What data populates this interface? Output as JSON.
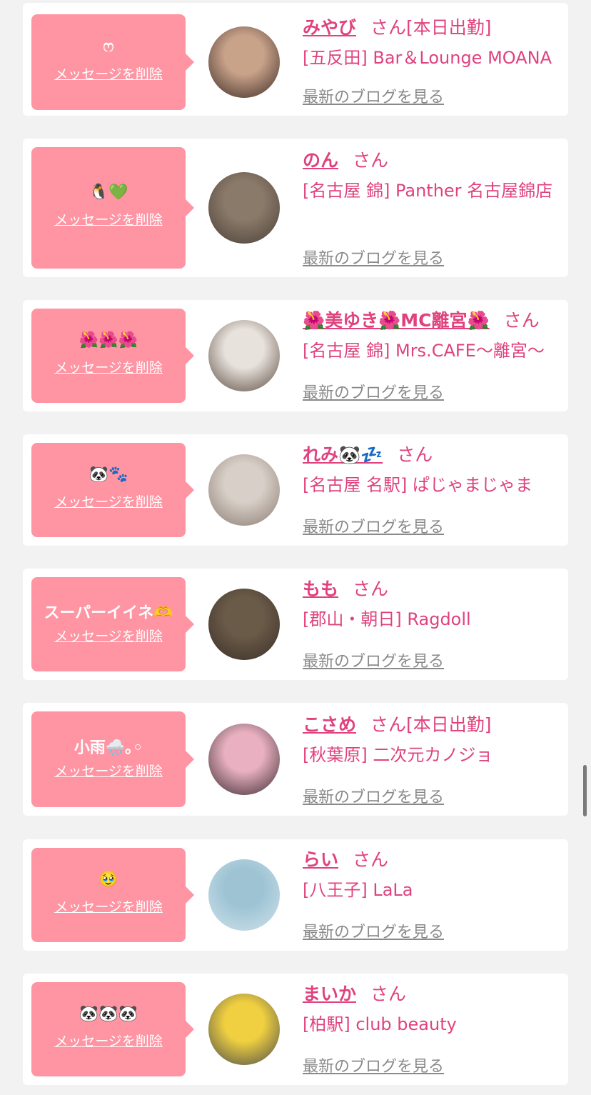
{
  "delete_label": "メッセージを削除",
  "blog_label": "最新のブログを見る",
  "san_label": "さん",
  "cards": [
    {
      "message": "ෆ",
      "name": "みやび",
      "status": "[本日出勤]",
      "shop": "[五反田] Bar＆Lounge MOANA",
      "avatar_colors": [
        "#c9a28a",
        "#3b2a24"
      ]
    },
    {
      "message": "🐧💚",
      "name": "のん",
      "status": "",
      "shop": "[名古屋 錦] Panther 名古屋錦店",
      "avatar_colors": [
        "#8a7a6a",
        "#4a3f36"
      ]
    },
    {
      "message": "🌺🌺🌺",
      "name": "🌺美ゆき🌺MC離宮🌺",
      "status": "",
      "shop": "[名古屋 錦] Mrs.CAFE〜離宮〜",
      "avatar_colors": [
        "#e8e2dc",
        "#5a4a40"
      ]
    },
    {
      "message": "🐼🐾",
      "name": "れみ🐼💤",
      "status": "",
      "shop": "[名古屋 名駅] ぱじゃまじゃま",
      "avatar_colors": [
        "#d8d0c8",
        "#8a7a70"
      ]
    },
    {
      "message": "スーパーイイネ🫶",
      "name": "もも",
      "status": "",
      "shop": "[郡山・朝日] Ragdoll",
      "avatar_colors": [
        "#6a5a48",
        "#3a3028"
      ]
    },
    {
      "message": "小雨🌧️｡◦",
      "name": "こさめ",
      "status": "[本日出勤]",
      "shop": "[秋葉原] 二次元カノジョ",
      "avatar_colors": [
        "#e8b0c0",
        "#3a2a30"
      ]
    },
    {
      "message": "🥹",
      "name": "らい",
      "status": "",
      "shop": "[八王子] LaLa",
      "avatar_colors": [
        "#9ec4d4",
        "#cfe2ea"
      ]
    },
    {
      "message": "🐼🐼🐼",
      "name": "まいか",
      "status": "",
      "shop": "[柏駅] club beauty",
      "avatar_colors": [
        "#f0d040",
        "#4a4a4a"
      ]
    }
  ]
}
